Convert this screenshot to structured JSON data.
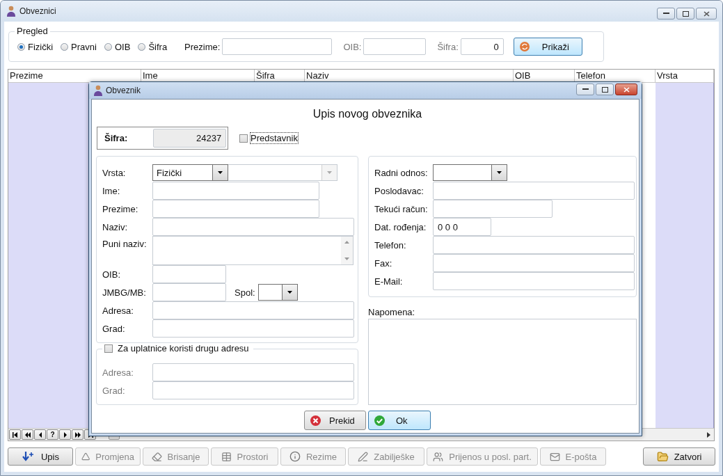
{
  "window": {
    "title": "Obveznici"
  },
  "pregled": {
    "title": "Pregled",
    "radios": [
      {
        "label": "Fizički",
        "selected": true
      },
      {
        "label": "Pravni",
        "selected": false
      },
      {
        "label": "OIB",
        "selected": false
      },
      {
        "label": "Šifra",
        "selected": false
      }
    ],
    "prezime_label": "Prezime:",
    "oib_label": "OIB:",
    "sifra_label": "Šifra:",
    "sifra_value": "0",
    "button": "Prikaži"
  },
  "grid": {
    "columns": [
      "Prezime",
      "Ime",
      "Šifra",
      "Naziv",
      "OIB",
      "Telefon",
      "Vrsta"
    ]
  },
  "navigator": {
    "help_key": "?"
  },
  "toolbar": [
    {
      "label": "Upis",
      "disabled": false
    },
    {
      "label": "Promjena",
      "disabled": true
    },
    {
      "label": "Brisanje",
      "disabled": true
    },
    {
      "label": "Prostori",
      "disabled": true
    },
    {
      "label": "Rezime",
      "disabled": true
    },
    {
      "label": "Zabilješke",
      "disabled": true
    },
    {
      "label": "Prijenos u posl. part.",
      "disabled": true
    },
    {
      "label": "E-pošta",
      "disabled": true
    },
    {
      "label": "Zatvori",
      "disabled": false
    }
  ],
  "dialog": {
    "title": "Obveznik",
    "heading": "Upis novog obveznika",
    "sifra": {
      "label": "Šifra:",
      "value": "24237"
    },
    "predstavnik": {
      "label": "Predstavnik",
      "checked": false
    },
    "left_fields": [
      {
        "label": "Vrsta:",
        "kind": "combo2",
        "value": "Fizički"
      },
      {
        "label": "Ime:",
        "kind": "text"
      },
      {
        "label": "Prezime:",
        "kind": "text"
      },
      {
        "label": "Naziv:",
        "kind": "text"
      },
      {
        "label": "Puni naziv:",
        "kind": "memo"
      },
      {
        "label": "OIB:",
        "kind": "text"
      },
      {
        "label": "JMBG/MB:",
        "kind": "text",
        "extra_label": "Spol:"
      },
      {
        "label": "Adresa:",
        "kind": "text"
      },
      {
        "label": "Grad:",
        "kind": "text"
      }
    ],
    "right_fields": [
      {
        "label": "Radni odnos:",
        "kind": "combo"
      },
      {
        "label": "Poslodavac:",
        "kind": "text"
      },
      {
        "label": "Tekući račun:",
        "kind": "text"
      },
      {
        "label": "Dat. rođenja:",
        "kind": "text",
        "value": "0 0 0"
      },
      {
        "label": "Telefon:",
        "kind": "text"
      },
      {
        "label": "Fax:",
        "kind": "text"
      },
      {
        "label": "E-Mail:",
        "kind": "text"
      }
    ],
    "napomena_label": "Napomena:",
    "alt_address": {
      "label": "Za uplatnice koristi drugu adresu",
      "checked": false,
      "fields": [
        {
          "label": "Adresa:"
        },
        {
          "label": "Grad:"
        }
      ]
    },
    "buttons": [
      {
        "label": "Prekid",
        "kind": "cancel"
      },
      {
        "label": "Ok",
        "kind": "ok"
      }
    ]
  }
}
